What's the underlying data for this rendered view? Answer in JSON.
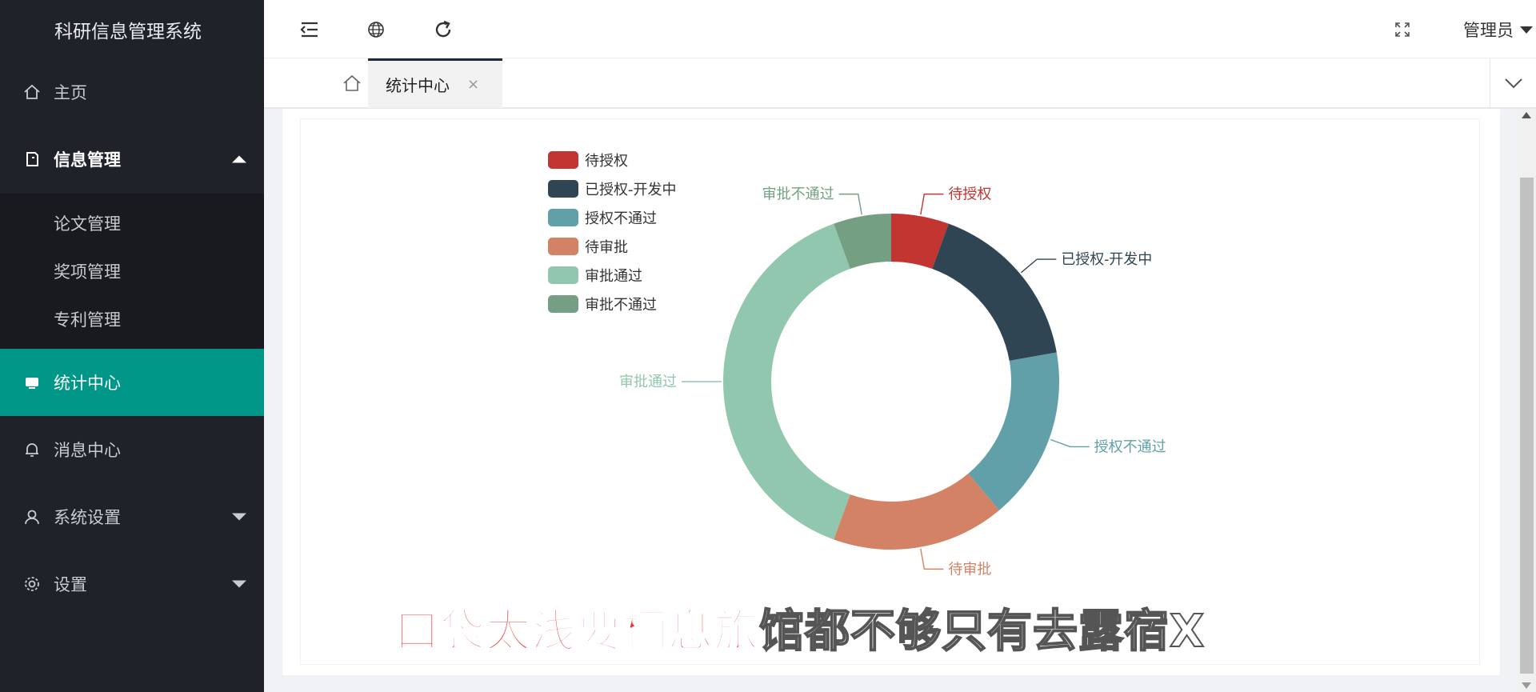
{
  "app": {
    "title": "科研信息管理系统"
  },
  "sidebar": {
    "items": [
      {
        "label": "主页",
        "icon": "home-icon"
      },
      {
        "label": "信息管理",
        "icon": "document-icon",
        "expanded": true
      },
      {
        "label": "统计中心",
        "icon": "monitor-icon",
        "active": true
      },
      {
        "label": "消息中心",
        "icon": "bell-icon"
      },
      {
        "label": "系统设置",
        "icon": "user-icon"
      },
      {
        "label": "设置",
        "icon": "gear-icon"
      }
    ],
    "subitems": [
      "论文管理",
      "奖项管理",
      "专利管理"
    ]
  },
  "header": {
    "buttons": [
      "menu-fold-icon",
      "globe-icon",
      "refresh-icon",
      "fullscreen-icon"
    ],
    "user": "管理员"
  },
  "tabs": {
    "active_label": "统计中心",
    "close_glyph": "×"
  },
  "chart_data": {
    "type": "pie",
    "donut": true,
    "categories": [
      "待授权",
      "已授权-开发中",
      "授权不通过",
      "待审批",
      "审批通过",
      "审批不通过"
    ],
    "values": [
      1,
      3,
      3,
      3,
      7,
      1
    ],
    "colors": [
      "#c23531",
      "#2f4554",
      "#61a0a8",
      "#d48265",
      "#91c7ae",
      "#749f83"
    ],
    "legend_position": "top-left"
  },
  "overlay": {
    "red_text": "口袋太浅要栖息旅",
    "grey_text": "馆都不够只有去露宿X"
  }
}
